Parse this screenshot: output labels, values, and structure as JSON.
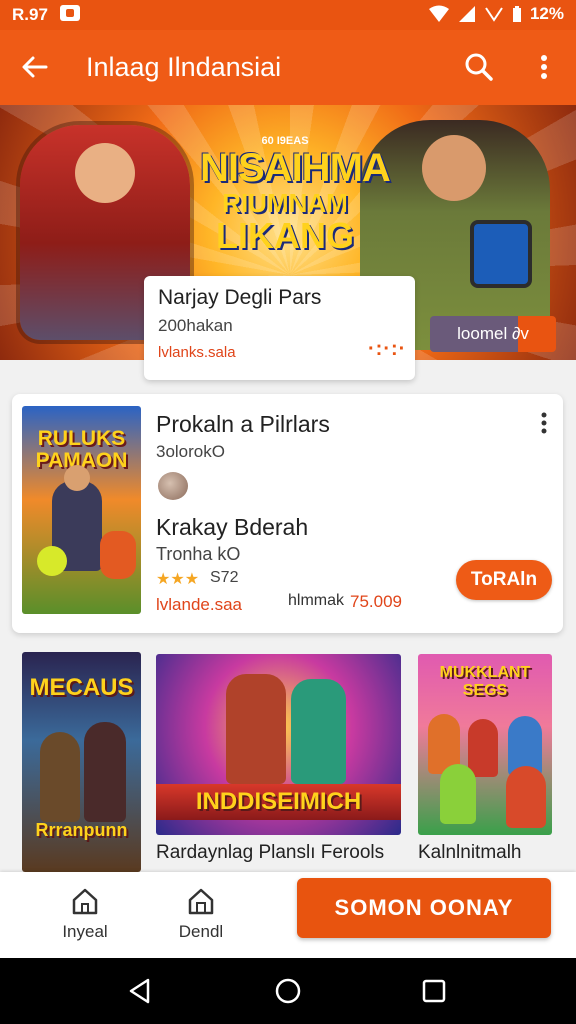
{
  "status_bar": {
    "time": "R.97",
    "battery": "12%"
  },
  "app_bar": {
    "title": "Inlaag Ilndansiai"
  },
  "hero": {
    "logo_tag": "60 I9EAS",
    "logo_line1": "NISAIHMA",
    "logo_line2": "RIUMNAM",
    "logo_line3": "LIKANG",
    "promo_label": "loomel ∂v"
  },
  "featured": {
    "title": "Narjay Degli Pars",
    "subtitle": "200hakan",
    "tag": "lvlanks.sala",
    "dots": "·:·:·"
  },
  "list_item": {
    "cover_title": "RULUKS PAMAON",
    "title": "Prokaln a Pilrlars",
    "subtitle": "3olorokO",
    "title2": "Krakay Bderah",
    "subtitle2": "Tronha kO",
    "stars": "★★★",
    "rating": "S72",
    "tag": "lvlande.saa",
    "price_label": "hlmmak",
    "price": "75.009",
    "button_label": "ToRAln"
  },
  "tiles": [
    {
      "title": "MECAUS",
      "subtitle": "Rrranpunn"
    },
    {
      "title": "INDDISEIMICH",
      "caption": "Rardaynlag Planslı Ferools"
    },
    {
      "title": "MUKKLANT SEGS",
      "caption": "Kalnlnitmalh"
    }
  ],
  "bottom_nav": {
    "item1": "Inyeal",
    "item2": "Dendl",
    "cta": "SOMON OONAY"
  },
  "colors": {
    "brand": "#ee5b16",
    "accent_text": "#e0451a",
    "cta": "#e8540f"
  }
}
